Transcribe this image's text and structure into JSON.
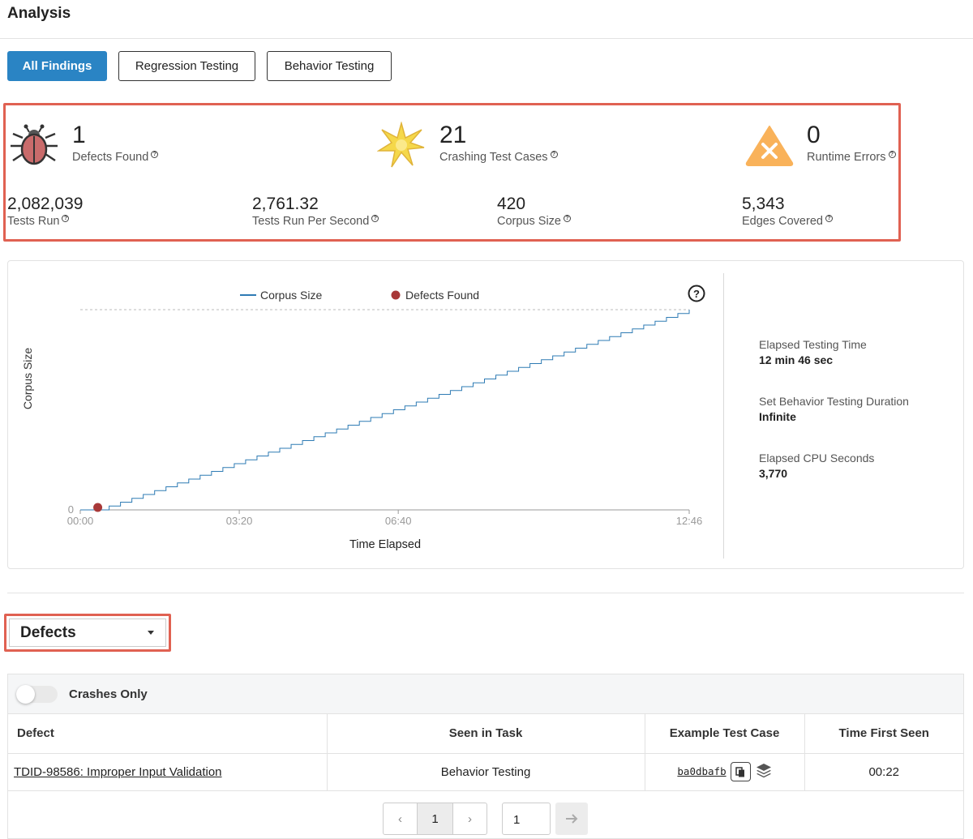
{
  "page": {
    "title": "Analysis"
  },
  "tabs": [
    {
      "label": "All Findings",
      "active": true
    },
    {
      "label": "Regression Testing",
      "active": false
    },
    {
      "label": "Behavior Testing",
      "active": false
    }
  ],
  "top_stats": {
    "defects": {
      "value": "1",
      "label": "Defects Found"
    },
    "crashing": {
      "value": "21",
      "label": "Crashing Test Cases"
    },
    "runtime": {
      "value": "0",
      "label": "Runtime Errors"
    }
  },
  "metrics": [
    {
      "value": "2,082,039",
      "label": "Tests Run"
    },
    {
      "value": "2,761.32",
      "label": "Tests Run Per Second"
    },
    {
      "value": "420",
      "label": "Corpus Size"
    },
    {
      "value": "5,343",
      "label": "Edges Covered"
    }
  ],
  "help_glyph": "?",
  "chart_data": {
    "type": "line",
    "xlabel": "Time Elapsed",
    "ylabel": "Corpus Size",
    "x_ticks": [
      "00:00",
      "03:20",
      "06:40",
      "12:46"
    ],
    "y_ticks": [
      "0"
    ],
    "xlim_seconds": [
      0,
      766
    ],
    "ylim": [
      0,
      420
    ],
    "legend": "top-center",
    "series": [
      {
        "name": "Corpus Size",
        "color": "#2e7bb4",
        "x_seconds": [
          22,
          766
        ],
        "y": [
          0,
          420
        ],
        "shape": "stepped"
      },
      {
        "name": "Defects Found",
        "color": "#a83838",
        "x_seconds": [
          22
        ],
        "y": [
          0
        ]
      }
    ],
    "max_reference_line": true
  },
  "chart_meta": {
    "legend_corpus": "Corpus Size",
    "legend_defects": "Defects Found"
  },
  "side_info": [
    {
      "label": "Elapsed Testing Time",
      "value": "12 min 46 sec"
    },
    {
      "label": "Set Behavior Testing Duration",
      "value": "Infinite"
    },
    {
      "label": "Elapsed CPU Seconds",
      "value": "3,770"
    }
  ],
  "defects_dropdown": {
    "selected": "Defects"
  },
  "filter": {
    "label": "Crashes Only",
    "on": false
  },
  "table": {
    "headers": [
      "Defect",
      "Seen in Task",
      "Example Test Case",
      "Time First Seen"
    ],
    "rows": [
      {
        "defect": "TDID-98586: Improper Input Validation",
        "task": "Behavior Testing",
        "test_case": "ba0dbafb",
        "time": "00:22"
      }
    ]
  },
  "pagination": {
    "current": "1",
    "jump_value": "1"
  },
  "colors": {
    "accent": "#2a84c4",
    "highlight": "#e06152",
    "bug": "#c96b6b",
    "burst": "#f5d84a",
    "warning": "#f9b25a"
  }
}
